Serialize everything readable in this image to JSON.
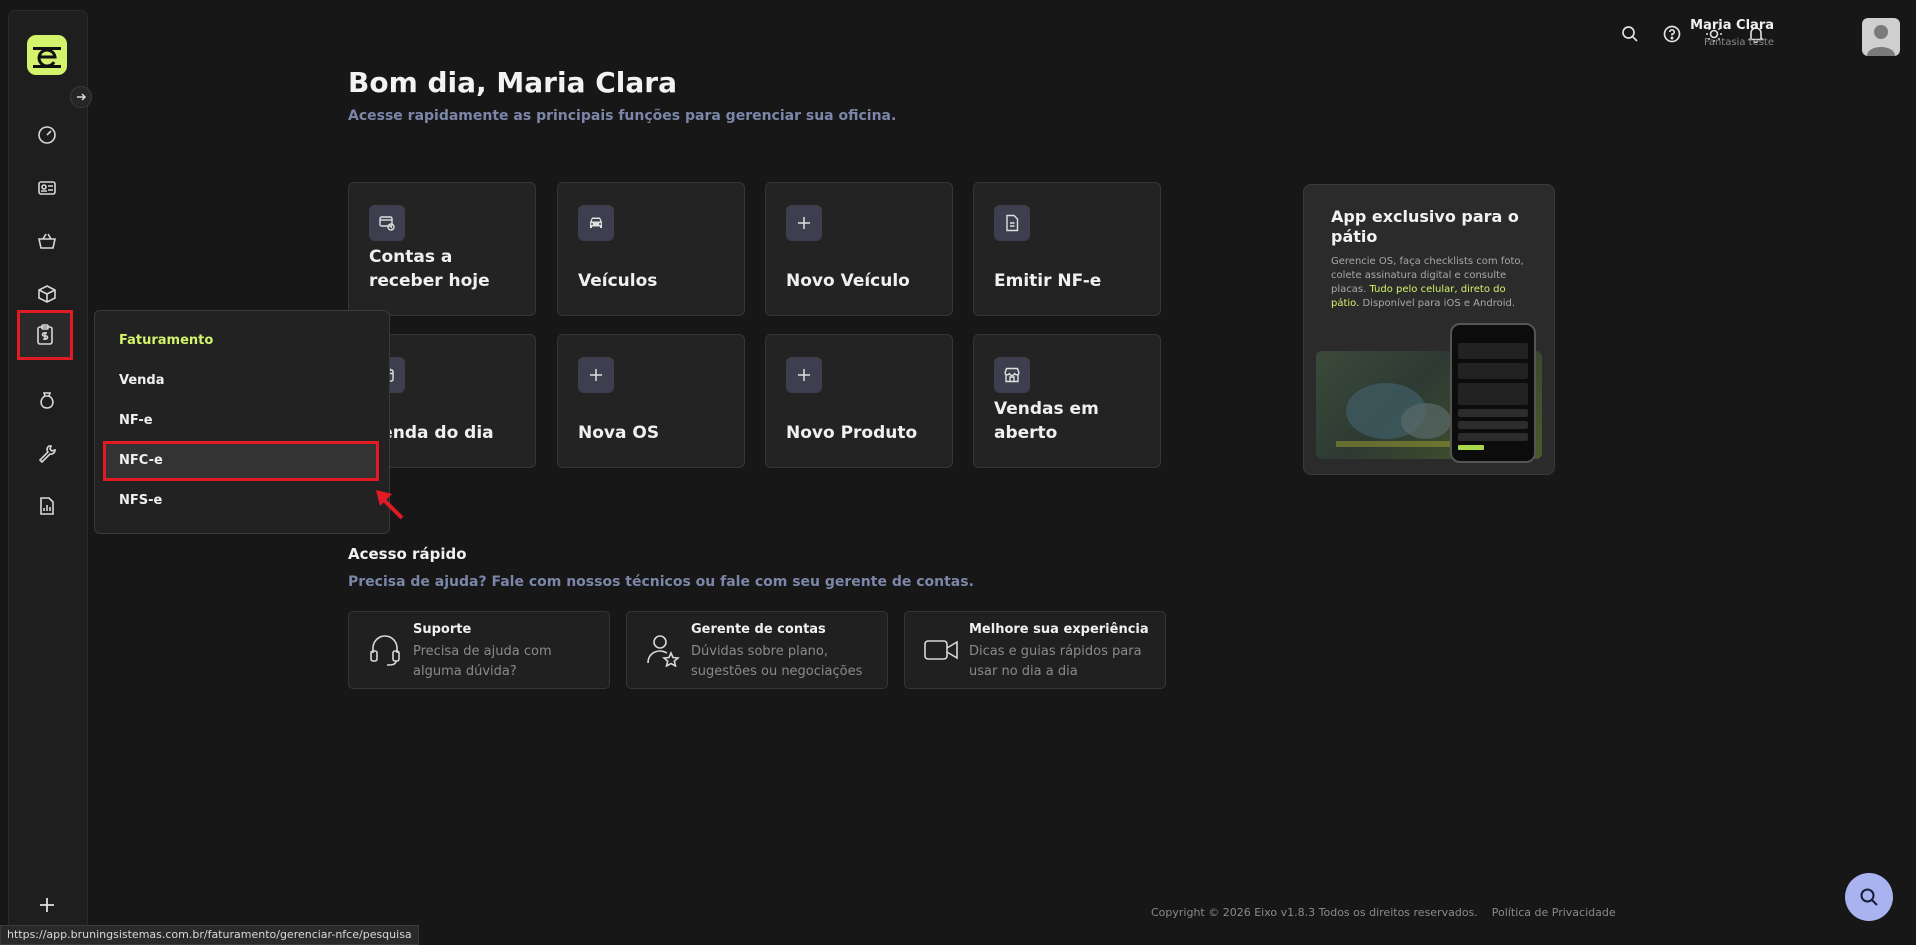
{
  "header": {
    "user_name": "Maria Clara",
    "user_subtitle": "Fantasia teste",
    "icons": [
      "search-icon",
      "help-icon",
      "sun-icon",
      "bell-icon"
    ]
  },
  "greeting": {
    "title": "Bom dia, Maria Clara",
    "subtitle": "Acesse rapidamente as principais funções para gerenciar sua oficina."
  },
  "cards": [
    {
      "label": "Contas a receber hoje",
      "icon": "receipt-icon"
    },
    {
      "label": "Veículos",
      "icon": "car-icon"
    },
    {
      "label": "Novo Veículo",
      "icon": "plus-icon"
    },
    {
      "label": "Emitir NF-e",
      "icon": "document-icon"
    },
    {
      "label": "Venda do dia",
      "icon": "calendar-icon"
    },
    {
      "label": "Nova OS",
      "icon": "plus-icon"
    },
    {
      "label": "Novo Produto",
      "icon": "plus-icon"
    },
    {
      "label": "Vendas em aberto",
      "icon": "store-icon"
    }
  ],
  "promo": {
    "title": "App exclusivo para o pátio",
    "text_a": "Gerencie OS, faça checklists com foto, colete assinatura digital e consulte placas. ",
    "text_highlight": "Tudo pelo celular, direto do pátio.",
    "text_b": " Disponível para iOS e Android."
  },
  "menu": {
    "header": "Faturamento",
    "items": [
      "Venda",
      "NF-e",
      "NFC-e",
      "NFS-e"
    ]
  },
  "quick_access": {
    "title": "Acesso rápido",
    "subtitle": "Precisa de ajuda? Fale com nossos técnicos ou fale com seu gerente de contas.",
    "items": [
      {
        "title": "Suporte",
        "text": "Precisa de ajuda com alguma dúvida?"
      },
      {
        "title": "Gerente de contas",
        "text": "Dúvidas sobre plano, sugestões ou negociações"
      },
      {
        "title": "Melhore sua experiência",
        "text": "Dicas e guias rápidos para usar no dia a dia"
      }
    ]
  },
  "footer": {
    "copyright": "Copyright © 2026 Eixo v1.8.3 Todos os direitos reservados.",
    "privacy": "Política de Privacidade"
  },
  "status_url": "https://app.bruningsistemas.com.br/faturamento/gerenciar-nfce/pesquisa",
  "colors": {
    "accent": "#d2f36b",
    "highlight": "#e01b24",
    "fab": "#a9b3f0"
  }
}
